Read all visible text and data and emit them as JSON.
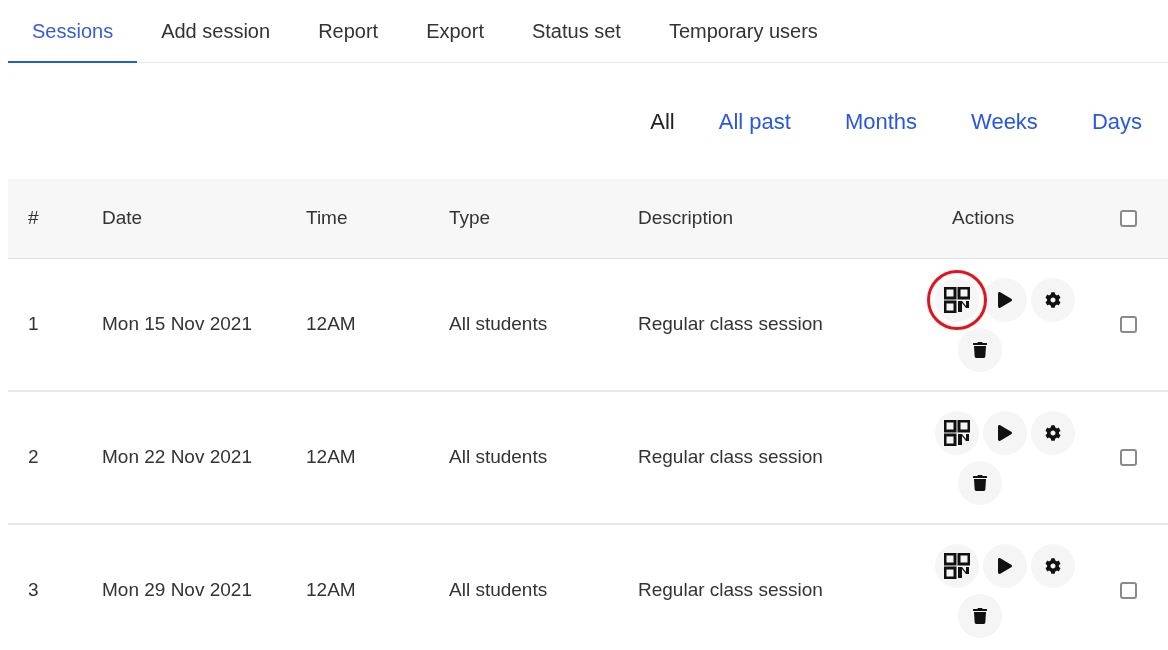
{
  "tabs": [
    {
      "label": "Sessions",
      "selected": true
    },
    {
      "label": "Add session",
      "selected": false
    },
    {
      "label": "Report",
      "selected": false
    },
    {
      "label": "Export",
      "selected": false
    },
    {
      "label": "Status set",
      "selected": false
    },
    {
      "label": "Temporary users",
      "selected": false
    }
  ],
  "filters": [
    {
      "label": "All",
      "selected": true
    },
    {
      "label": "All past",
      "selected": false
    },
    {
      "label": "Months",
      "selected": false
    },
    {
      "label": "Weeks",
      "selected": false
    },
    {
      "label": "Days",
      "selected": false
    }
  ],
  "table": {
    "columns": [
      "#",
      "Date",
      "Time",
      "Type",
      "Description",
      "Actions"
    ],
    "select_all": {
      "checked": false
    },
    "rows": [
      {
        "number": "1",
        "date": "Mon 15 Nov 2021",
        "time": "12AM",
        "type": "All students",
        "description": "Regular class session",
        "checked": false,
        "qr_circled": true
      },
      {
        "number": "2",
        "date": "Mon 22 Nov 2021",
        "time": "12AM",
        "type": "All students",
        "description": "Regular class session",
        "checked": false,
        "qr_circled": false
      },
      {
        "number": "3",
        "date": "Mon 29 Nov 2021",
        "time": "12AM",
        "type": "All students",
        "description": "Regular class session",
        "checked": false,
        "qr_circled": false
      }
    ]
  }
}
